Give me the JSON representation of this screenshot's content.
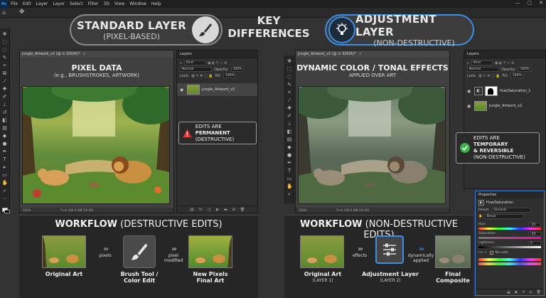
{
  "app": {
    "logo": "Ps",
    "menu": [
      "File",
      "Edit",
      "Layer",
      "Layer",
      "Select",
      "Filter",
      "3D",
      "View",
      "Window",
      "Help"
    ],
    "window_controls": [
      "—",
      "▢",
      "✕"
    ]
  },
  "header": {
    "left": {
      "title": "STANDARD LAYER",
      "subtitle": "(PIXEL-BASED)"
    },
    "center": {
      "line1": "KEY",
      "line2": "DIFFERENCES"
    },
    "right": {
      "title": "ADJUSTMENT LAYER",
      "subtitle": "(NON-DESTRUCTIVE)"
    }
  },
  "left_doc": {
    "tab": "Jungle_Artwork_v2 (@ ⊙ 320(R)*",
    "heading": "PIXEL DATA",
    "subheading": "(e.g., BRUSHSTROKES, ARTWORK)",
    "status_zoom": "320%",
    "status_info": "7×m 100 0 (8B CIA 00)"
  },
  "left_layers": {
    "panel_title": "Layers",
    "kind": "Kind",
    "blend": "Normal",
    "opacity_label": "Opacity:",
    "opacity": "100%",
    "lock_label": "Lock:",
    "fill_label": "Fill:",
    "fill": "100%",
    "layers": [
      {
        "name": "Jungle_Artwork_v2"
      }
    ]
  },
  "left_callout": {
    "prefix": "EDITS ARE ",
    "strong": "PERMANENT",
    "line2": "(DESTRUCTIVE)"
  },
  "right_doc": {
    "tab": "Jungle_Artwork_v2 (@ ⊙ 320(R)*",
    "heading": "DYNAMIC COLOR / TONAL EFFECTS",
    "subheading": "APPLIED OVER ART",
    "status_zoom": "320%",
    "status_info": "7×m 100 0 (8B CIA 00)"
  },
  "right_layers": {
    "panel_title": "Layers",
    "kind": "Kind",
    "blend": "Normal",
    "opacity_label": "Opacity:",
    "opacity": "100%",
    "lock_label": "Lock:",
    "fill_label": "Fill:",
    "fill": "100%",
    "layers": [
      {
        "name": "Hue/Saturation_1"
      },
      {
        "name": "Jungle_Artwork_v2"
      }
    ]
  },
  "right_callout": {
    "prefix": "EDITS ARE ",
    "strong": "TEMPORARY",
    "line2": "& REVERSIBLE",
    "line3": "(NON-DESTRUCTIVE)"
  },
  "workflow_left": {
    "title_bold": "WORKFLOW",
    "title_rest": " (DESTRUCTIVE EDITS)",
    "step1": "Original Art",
    "arrow1": "pixels",
    "step2_l1": "Brush Tool /",
    "step2_l2": "Color Edit",
    "arrow2_l1": "pixel",
    "arrow2_l2": "modified",
    "step3_l1": "New Pixels",
    "step3_l2": "Final Art"
  },
  "workflow_right": {
    "title_bold": "WORKFLOW",
    "title_rest": " (NON-DESTRUCTIVE EDITS)",
    "step1": "Original Art",
    "step1_sub": "(LAYER 1)",
    "arrow1": "effects",
    "step2": "Adjustment Layer",
    "step2_sub": "(LAYER 2)",
    "arrow2_l1": "dynamically",
    "arrow2_l2": "applied",
    "step3_l1": "Final",
    "step3_l2": "Composite"
  },
  "properties": {
    "title": "Properties",
    "adj_name": "Hue/Saturation",
    "preset_label": "Preset:",
    "preset": "General",
    "channel": "Neval",
    "hue_label": "Hue:",
    "hue": "-15",
    "saturation_label": "Saturation:",
    "saturation": "-20",
    "lightness_label": "Lightness:",
    "lightness": "0",
    "colorize_label": "No ratio"
  },
  "colors": {
    "accent_blue": "#3a8fe8",
    "warning_red": "#e03030",
    "success_green": "#3cb44b"
  }
}
